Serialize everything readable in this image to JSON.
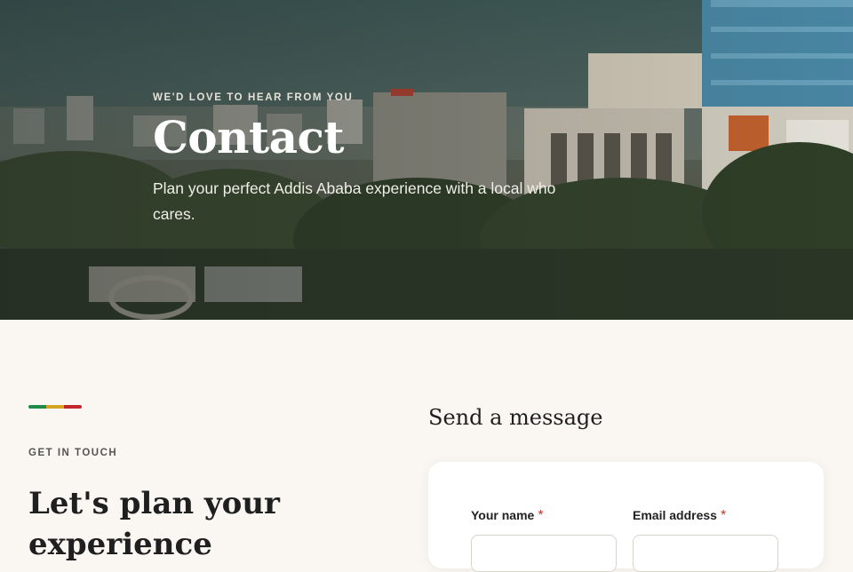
{
  "hero": {
    "eyebrow": "WE'D LOVE TO HEAR FROM YOU",
    "title": "Contact",
    "subtitle": "Plan your perfect Addis Ababa experience with a local who cares."
  },
  "intro": {
    "eyebrow": "GET IN TOUCH",
    "heading": "Let's plan your experience",
    "flag_colors": [
      "#1f8a4c",
      "#d4a520",
      "#c1272d"
    ]
  },
  "form": {
    "heading": "Send a message",
    "name_label": "Your name",
    "email_label": "Email address",
    "required_mark": "*"
  },
  "colors": {
    "background": "#faf7f2",
    "card": "#ffffff",
    "required": "#c0392b"
  }
}
